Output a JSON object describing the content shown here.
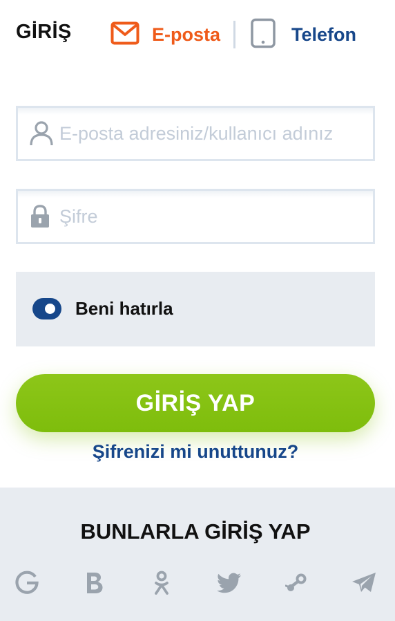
{
  "header": {
    "title": "GİRİŞ",
    "tabs": [
      {
        "label": "E-posta",
        "icon": "envelope-icon",
        "active": true,
        "color": "#ef5b1a"
      },
      {
        "label": "Telefon",
        "icon": "phone-icon",
        "active": false,
        "color": "#17478a"
      }
    ]
  },
  "form": {
    "username": {
      "placeholder": "E-posta adresiniz/kullanıcı adınız",
      "value": "",
      "icon": "user-icon"
    },
    "password": {
      "placeholder": "Şifre",
      "value": "",
      "icon": "lock-icon"
    },
    "remember": {
      "label": "Beni hatırla",
      "checked": true
    },
    "submit_label": "GİRİŞ YAP",
    "forgot_label": "Şifrenizi mi unuttunuz?"
  },
  "social": {
    "heading": "BUNLARLA GİRİŞ YAP",
    "providers": [
      {
        "name": "Google",
        "icon": "google-icon"
      },
      {
        "name": "VKontakte",
        "icon": "vk-icon"
      },
      {
        "name": "Odnoklassniki",
        "icon": "odnoklassniki-icon"
      },
      {
        "name": "Twitter",
        "icon": "twitter-icon"
      },
      {
        "name": "Steam",
        "icon": "steam-icon"
      },
      {
        "name": "Telegram",
        "icon": "telegram-icon"
      }
    ]
  },
  "colors": {
    "accent_orange": "#ef5b1a",
    "brand_blue": "#17478a",
    "button_green": "#84c20f",
    "panel_gray": "#e8ecf1",
    "icon_gray": "#9aa3ad"
  }
}
